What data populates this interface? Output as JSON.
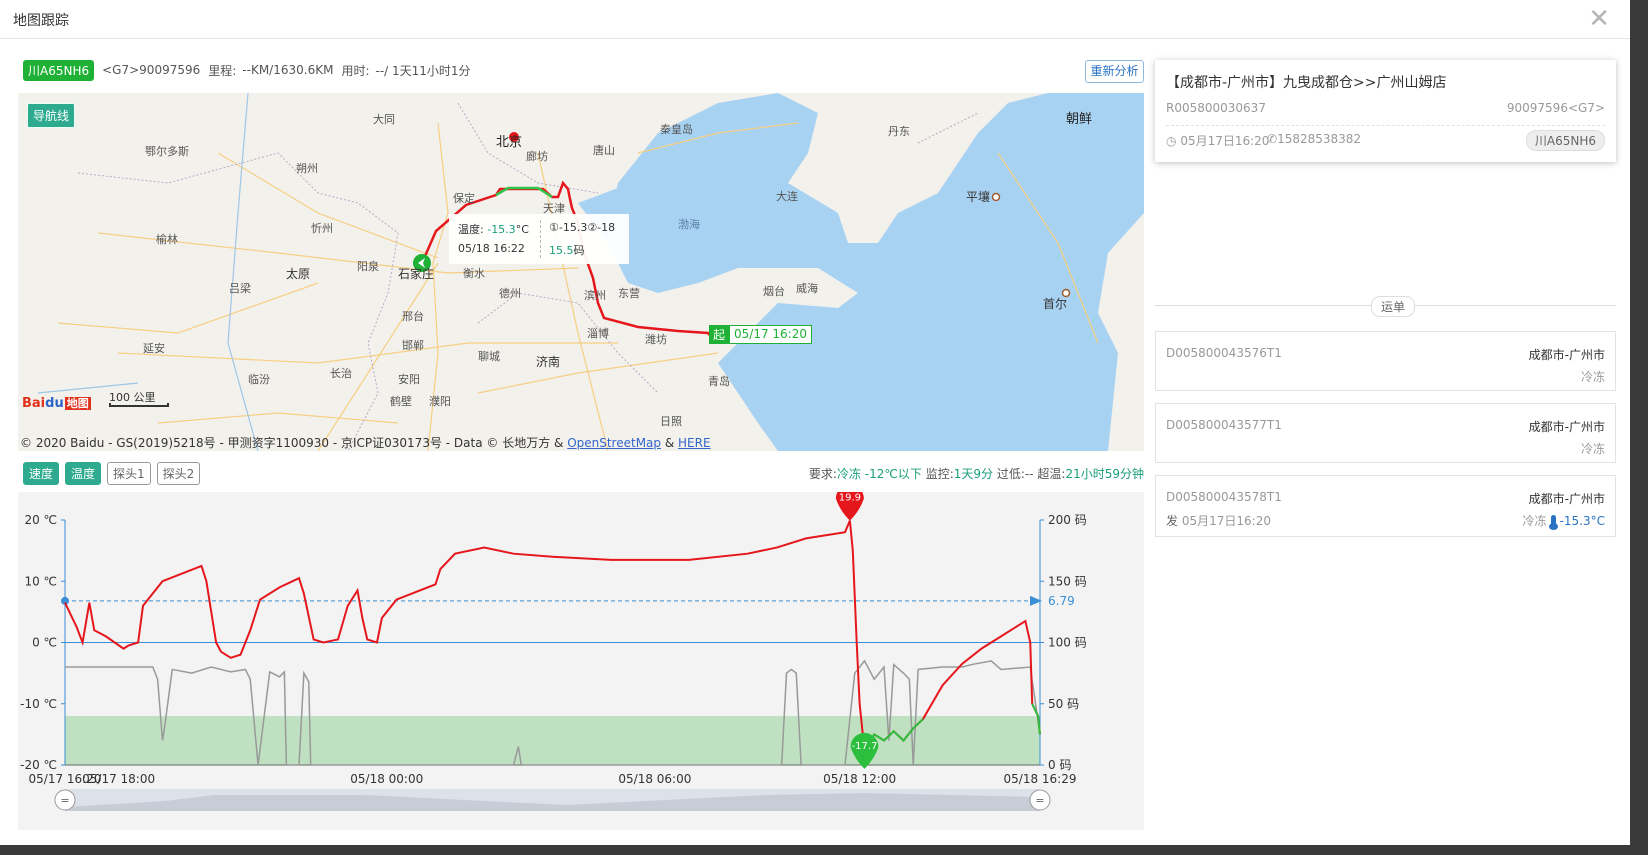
{
  "modal": {
    "title": "地图跟踪",
    "close_icon": "close-icon"
  },
  "vehicle": {
    "plate": "川A65NH6",
    "device": "<G7>90097596",
    "mileage_label": "里程:",
    "mileage": "--KM/1630.6KM",
    "time_label": "用时:",
    "time": "--/ 1天11小时1分"
  },
  "reanalyze_label": "重新分析",
  "map": {
    "navline_label": "导航线",
    "labels": [
      {
        "text": "北京",
        "cls": "big"
      },
      {
        "text": "廊坊",
        "cls": ""
      },
      {
        "text": "唐山",
        "cls": ""
      },
      {
        "text": "秦皇岛",
        "cls": ""
      },
      {
        "text": "丹东",
        "cls": ""
      },
      {
        "text": "朝鲜",
        "cls": "big"
      },
      {
        "text": "鄂尔多斯",
        "cls": ""
      },
      {
        "text": "大同",
        "cls": ""
      },
      {
        "text": "朔州",
        "cls": ""
      },
      {
        "text": "保定",
        "cls": ""
      },
      {
        "text": "天津",
        "cls": ""
      },
      {
        "text": "忻州",
        "cls": ""
      },
      {
        "text": "榆林",
        "cls": ""
      },
      {
        "text": "大连",
        "cls": ""
      },
      {
        "text": "平壤",
        "cls": "city"
      },
      {
        "text": "渤海",
        "cls": "sea"
      },
      {
        "text": "太原",
        "cls": "city"
      },
      {
        "text": "阳泉",
        "cls": ""
      },
      {
        "text": "石家庄",
        "cls": "city"
      },
      {
        "text": "衡水",
        "cls": ""
      },
      {
        "text": "吕梁",
        "cls": ""
      },
      {
        "text": "德州",
        "cls": ""
      },
      {
        "text": "滨州",
        "cls": ""
      },
      {
        "text": "东营",
        "cls": ""
      },
      {
        "text": "烟台",
        "cls": ""
      },
      {
        "text": "威海",
        "cls": ""
      },
      {
        "text": "首尔",
        "cls": "city"
      },
      {
        "text": "邢台",
        "cls": ""
      },
      {
        "text": "淄博",
        "cls": ""
      },
      {
        "text": "潍坊",
        "cls": ""
      },
      {
        "text": "延安",
        "cls": ""
      },
      {
        "text": "邯郸",
        "cls": ""
      },
      {
        "text": "聊城",
        "cls": ""
      },
      {
        "text": "济南",
        "cls": "city"
      },
      {
        "text": "临汾",
        "cls": ""
      },
      {
        "text": "长治",
        "cls": ""
      },
      {
        "text": "安阳",
        "cls": ""
      },
      {
        "text": "青岛",
        "cls": ""
      },
      {
        "text": "鹤壁",
        "cls": ""
      },
      {
        "text": "濮阳",
        "cls": ""
      },
      {
        "text": "日照",
        "cls": ""
      }
    ],
    "popup": {
      "temp_label": "温度:",
      "temp_value": "-15.3",
      "temp_unit": "°C",
      "probes": "①-15.3②-18",
      "datetime": "05/18 16:22",
      "speed_value": "15.5",
      "speed_unit": "码"
    },
    "start_flag": {
      "badge": "起",
      "time": "05/17 16:20"
    },
    "scale": "100 公里",
    "baidu_logo": {
      "left": "Bai",
      "paw": "du",
      "tu": "地图"
    },
    "copyright": {
      "prefix": "© 2020 Baidu - GS(2019)5218号 - 甲测资字1100930 - 京ICP证030173号 - Data © 长地万方 & ",
      "osm": "OpenStreetMap",
      "amp": " & ",
      "here": "HERE"
    }
  },
  "chart_toolbar": {
    "buttons": [
      {
        "label": "速度",
        "active": true
      },
      {
        "label": "温度",
        "active": true
      },
      {
        "label": "探头1",
        "active": false
      },
      {
        "label": "探头2",
        "active": false
      }
    ],
    "meta": {
      "req_label": "要求:",
      "req_value": "冷冻 -12℃以下",
      "monitor_label": "监控:",
      "monitor_value": "1天9分",
      "low_label": "过低:",
      "low_value": "--",
      "high_label": "超温:",
      "high_value": "21小时59分钟"
    }
  },
  "chart_data": {
    "type": "line",
    "y_left": {
      "label": "℃",
      "ticks": [
        "20 ℃",
        "10 ℃",
        "0 ℃",
        "-10 ℃",
        "-20 ℃"
      ],
      "range": [
        -20,
        20
      ]
    },
    "y_right": {
      "label": "码",
      "ticks": [
        "200 码",
        "150 码",
        "100 码",
        "50 码",
        "0 码"
      ],
      "range": [
        0,
        200
      ]
    },
    "x_ticks": [
      "05/17 16:20",
      "05/17 18:00",
      "05/18 00:00",
      "05/18 06:00",
      "05/18 12:00",
      "05/18 16:29"
    ],
    "threshold": {
      "value": 6.79,
      "label": "6.79"
    },
    "low_band": [
      -20,
      -12
    ],
    "max_marker": "19.9",
    "min_marker": "-17.7",
    "series": [
      {
        "name": "温度",
        "color": "#e5171d",
        "points": [
          [
            0,
            6.5
          ],
          [
            0.012,
            2.5
          ],
          [
            0.018,
            0
          ],
          [
            0.025,
            6.5
          ],
          [
            0.03,
            2
          ],
          [
            0.042,
            1
          ],
          [
            0.06,
            -1
          ],
          [
            0.065,
            -0.5
          ],
          [
            0.075,
            0
          ],
          [
            0.08,
            6
          ],
          [
            0.1,
            10
          ],
          [
            0.14,
            12.5
          ],
          [
            0.145,
            10
          ],
          [
            0.155,
            0
          ],
          [
            0.16,
            -1.5
          ],
          [
            0.17,
            -2.5
          ],
          [
            0.18,
            -2
          ],
          [
            0.19,
            2
          ],
          [
            0.2,
            7
          ],
          [
            0.22,
            9
          ],
          [
            0.24,
            10.5
          ],
          [
            0.245,
            8
          ],
          [
            0.255,
            0.5
          ],
          [
            0.265,
            0
          ],
          [
            0.28,
            0.5
          ],
          [
            0.29,
            6
          ],
          [
            0.3,
            8.5
          ],
          [
            0.305,
            4
          ],
          [
            0.31,
            0.5
          ],
          [
            0.32,
            0
          ],
          [
            0.325,
            4
          ],
          [
            0.34,
            7
          ],
          [
            0.38,
            9.5
          ],
          [
            0.385,
            12
          ],
          [
            0.4,
            14.5
          ],
          [
            0.43,
            15.5
          ],
          [
            0.46,
            14.5
          ],
          [
            0.5,
            14
          ],
          [
            0.56,
            13.5
          ],
          [
            0.64,
            13.5
          ],
          [
            0.7,
            14.5
          ],
          [
            0.73,
            15.5
          ],
          [
            0.76,
            17
          ],
          [
            0.8,
            18
          ],
          [
            0.805,
            19.9
          ],
          [
            0.808,
            15
          ],
          [
            0.812,
            0
          ],
          [
            0.815,
            -10
          ],
          [
            0.82,
            -17.7
          ],
          [
            0.83,
            -15
          ],
          [
            0.84,
            -16
          ],
          [
            0.85,
            -14.5
          ],
          [
            0.86,
            -16
          ],
          [
            0.87,
            -14
          ],
          [
            0.88,
            -12.5
          ],
          [
            0.9,
            -7
          ],
          [
            0.92,
            -3.5
          ],
          [
            0.94,
            -1
          ],
          [
            0.96,
            1
          ],
          [
            0.975,
            2.5
          ],
          [
            0.985,
            3.5
          ],
          [
            0.99,
            0
          ],
          [
            0.992,
            -10
          ],
          [
            0.998,
            -12
          ],
          [
            1.0,
            -15
          ]
        ]
      },
      {
        "name": "速度",
        "color": "#999999",
        "points": [
          [
            0,
            80
          ],
          [
            0.05,
            80
          ],
          [
            0.09,
            80
          ],
          [
            0.095,
            70
          ],
          [
            0.1,
            20
          ],
          [
            0.102,
            30
          ],
          [
            0.11,
            78
          ],
          [
            0.13,
            75
          ],
          [
            0.15,
            80
          ],
          [
            0.17,
            76
          ],
          [
            0.185,
            78
          ],
          [
            0.19,
            70
          ],
          [
            0.198,
            0
          ],
          [
            0.21,
            76
          ],
          [
            0.22,
            72
          ],
          [
            0.225,
            76
          ],
          [
            0.227,
            0
          ],
          [
            0.24,
            0
          ],
          [
            0.245,
            75
          ],
          [
            0.25,
            68
          ],
          [
            0.252,
            0
          ],
          [
            0.46,
            0
          ],
          [
            0.465,
            15
          ],
          [
            0.468,
            0
          ],
          [
            0.735,
            0
          ],
          [
            0.74,
            75
          ],
          [
            0.745,
            78
          ],
          [
            0.75,
            75
          ],
          [
            0.755,
            0
          ],
          [
            0.8,
            0
          ],
          [
            0.81,
            75
          ],
          [
            0.82,
            85
          ],
          [
            0.83,
            70
          ],
          [
            0.84,
            80
          ],
          [
            0.845,
            20
          ],
          [
            0.85,
            82
          ],
          [
            0.86,
            75
          ],
          [
            0.866,
            70
          ],
          [
            0.87,
            0
          ],
          [
            0.875,
            78
          ],
          [
            0.9,
            80
          ],
          [
            0.92,
            80
          ],
          [
            0.93,
            82
          ],
          [
            0.95,
            85
          ],
          [
            0.96,
            78
          ],
          [
            0.99,
            80
          ],
          [
            1.0,
            25
          ]
        ]
      }
    ]
  },
  "order": {
    "title": "【成都市-广州市】九曳成都仓>>广州山姆店",
    "id": "R005800030637",
    "g7": "90097596<G7>",
    "time": "05月17日16:20",
    "phone": "15828538382",
    "plate": "川A65NH6"
  },
  "divider_label": "运单",
  "waybills": [
    {
      "code": "D005800043576T1",
      "route": "成都市-广州市",
      "type": "冷冻"
    },
    {
      "code": "D005800043577T1",
      "route": "成都市-广州市",
      "type": "冷冻"
    },
    {
      "code": "D005800043578T1",
      "route": "成都市-广州市",
      "sent_label": "发",
      "sent_time": "05月17日16:20",
      "type": "冷冻",
      "temp": "-15.3°C"
    }
  ]
}
